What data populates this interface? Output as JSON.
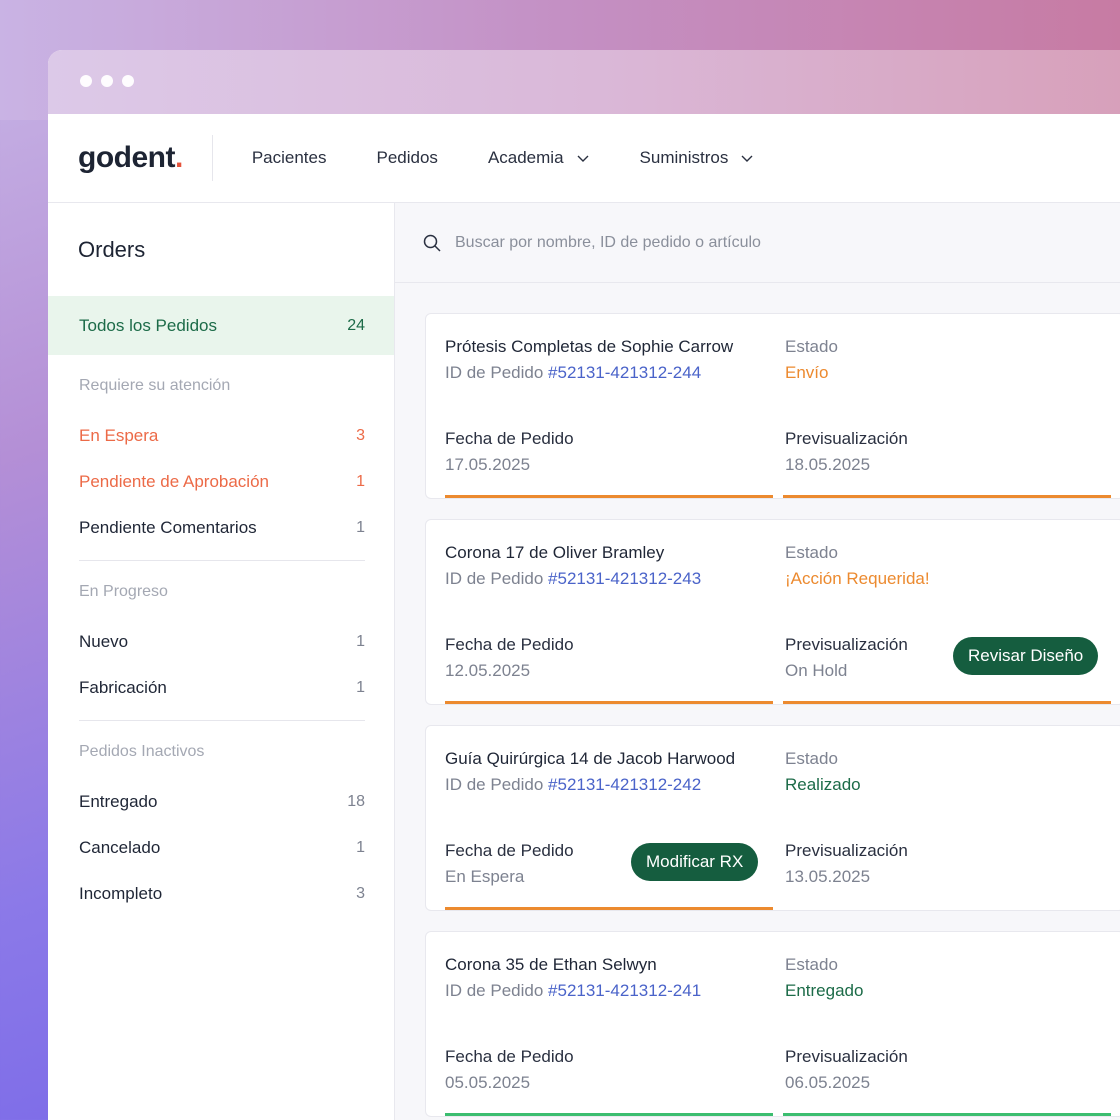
{
  "app": {
    "logo": "godent",
    "logo_dot": "."
  },
  "nav": {
    "items": [
      {
        "label": "Pacientes"
      },
      {
        "label": "Pedidos"
      },
      {
        "label": "Academia"
      },
      {
        "label": "Suministros"
      }
    ]
  },
  "sidebar": {
    "title": "Orders",
    "all": {
      "label": "Todos los Pedidos",
      "count": "24"
    },
    "attention": {
      "heading": "Requiere su atención",
      "items": [
        {
          "label": "En Espera",
          "count": "3"
        },
        {
          "label": "Pendiente de Aprobación",
          "count": "1"
        },
        {
          "label": "Pendiente Comentarios",
          "count": "1"
        }
      ]
    },
    "progress": {
      "heading": "En Progreso",
      "items": [
        {
          "label": "Nuevo",
          "count": "1"
        },
        {
          "label": "Fabricación",
          "count": "1"
        }
      ]
    },
    "inactive": {
      "heading": "Pedidos Inactivos",
      "items": [
        {
          "label": "Entregado",
          "count": "18"
        },
        {
          "label": "Cancelado",
          "count": "1"
        },
        {
          "label": "Incompleto",
          "count": "3"
        }
      ]
    }
  },
  "search": {
    "placeholder": "Buscar por nombre, ID de pedido o artículo"
  },
  "orders": [
    {
      "title": "Prótesis Completas de Sophie Carrow",
      "id_label": "ID de Pedido",
      "id": "#52131-421312-244",
      "status_label": "Estado",
      "status": "Envío",
      "date_label": "Fecha de Pedido",
      "date": "17.05.2025",
      "preview_label": "Previsualización",
      "preview": "18.05.2025"
    },
    {
      "title": "Corona 17 de Oliver Bramley",
      "id_label": "ID de Pedido",
      "id": "#52131-421312-243",
      "status_label": "Estado",
      "status": "¡Acción Requerida!",
      "date_label": "Fecha de Pedido",
      "date": "12.05.2025",
      "preview_label": "Previsualización",
      "preview": "On Hold",
      "action": "Revisar Diseño"
    },
    {
      "title": "Guía Quirúrgica 14 de Jacob Harwood",
      "id_label": "ID de Pedido",
      "id": "#52131-421312-242",
      "status_label": "Estado",
      "status": "Realizado",
      "date_label": "Fecha de Pedido",
      "date": "En Espera",
      "preview_label": "Previsualización",
      "preview": "13.05.2025",
      "action": "Modificar RX"
    },
    {
      "title": "Corona 35 de Ethan Selwyn",
      "id_label": "ID de Pedido",
      "id": "#52131-421312-241",
      "status_label": "Estado",
      "status": "Entregado",
      "date_label": "Fecha de Pedido",
      "date": "05.05.2025",
      "preview_label": "Previsualización",
      "preview": "06.05.2025"
    }
  ],
  "colors": {
    "accent_green": "#155d3f",
    "status_orange": "#ec8a2f",
    "warn_red": "#ec6a47",
    "link_blue": "#4a63c9",
    "progress_green": "#3bbd6f"
  }
}
